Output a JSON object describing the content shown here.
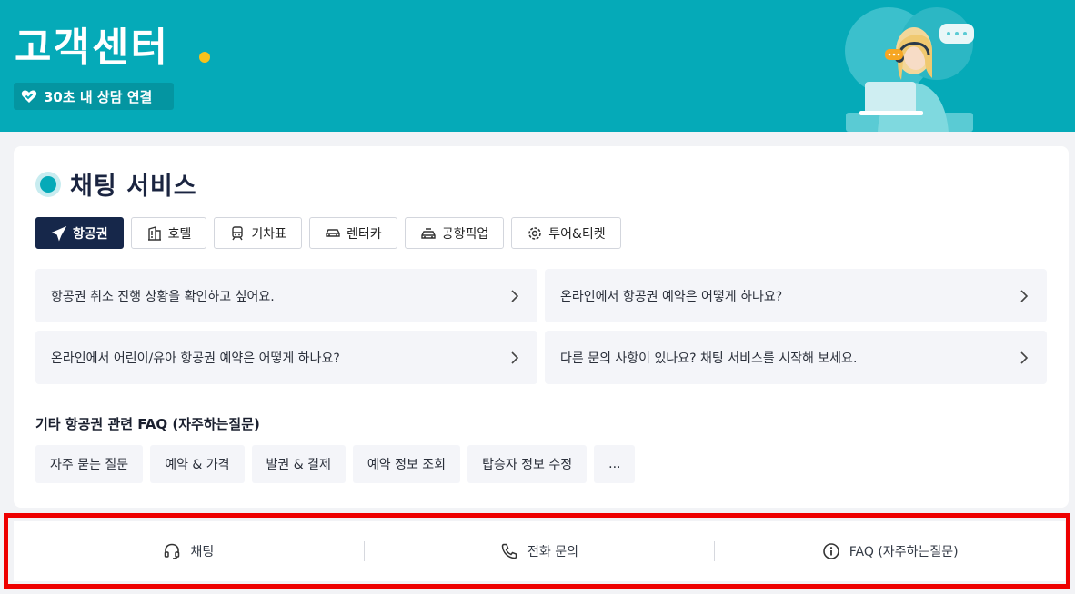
{
  "hero": {
    "title": "고객센터",
    "badge": "30초 내 상담 연결",
    "accent_color": "#05aab8",
    "dot_color": "#f6c21c"
  },
  "chat_section": {
    "title": "채팅 서비스",
    "tabs": [
      {
        "label": "항공권",
        "icon": "airplane-icon",
        "active": true
      },
      {
        "label": "호텔",
        "icon": "hotel-building-icon",
        "active": false
      },
      {
        "label": "기차표",
        "icon": "train-icon",
        "active": false
      },
      {
        "label": "렌터카",
        "icon": "car-icon",
        "active": false
      },
      {
        "label": "공항픽업",
        "icon": "pickup-car-icon",
        "active": false
      },
      {
        "label": "투어&티켓",
        "icon": "gear-badge-icon",
        "active": false
      }
    ],
    "faqs": [
      {
        "text": "항공권 취소 진행 상황을 확인하고 싶어요."
      },
      {
        "text": "온라인에서 항공권 예약은 어떻게 하나요?"
      },
      {
        "text": "온라인에서 어린이/유아 항공권 예약은 어떻게 하나요?"
      },
      {
        "text": "다른 문의 사항이 있나요? 채팅 서비스를 시작해 보세요."
      }
    ],
    "other_title": "기타 항공권 관련 FAQ (자주하는질문)",
    "chips": [
      "자주 묻는 질문",
      "예약 & 가격",
      "발권 & 결제",
      "예약 정보 조회",
      "탑승자 정보 수정",
      "..."
    ]
  },
  "bottom_bar": {
    "items": [
      {
        "label": "채팅",
        "icon": "headset-icon"
      },
      {
        "label": "전화 문의",
        "icon": "phone-icon"
      },
      {
        "label": "FAQ (자주하는질문)",
        "icon": "info-circle-icon"
      }
    ]
  }
}
